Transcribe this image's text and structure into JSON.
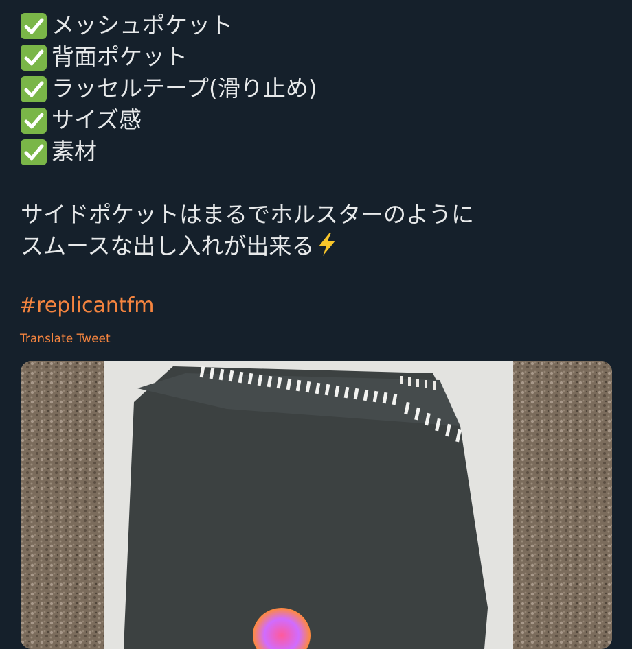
{
  "tweet": {
    "checklist": [
      {
        "label": "メッシュポケット",
        "icon": "check-mark-icon"
      },
      {
        "label": "背面ポケット",
        "icon": "check-mark-icon"
      },
      {
        "label": "ラッセルテープ(滑り止め)",
        "icon": "check-mark-icon"
      },
      {
        "label": "サイズ感",
        "icon": "check-mark-icon"
      },
      {
        "label": "素材",
        "icon": "check-mark-icon"
      }
    ],
    "paragraph_line1": "サイドポケットはまるでホルスターのように",
    "paragraph_line2": "スムースな出し入れが出来る",
    "paragraph_emoji": "lightning-bolt-icon",
    "hashtag": "#replicantfm",
    "translate_label": "Translate Tweet"
  },
  "colors": {
    "background": "#15202b",
    "text": "#e7e9ea",
    "accent": "#f4843f",
    "check": "#7ab648"
  }
}
